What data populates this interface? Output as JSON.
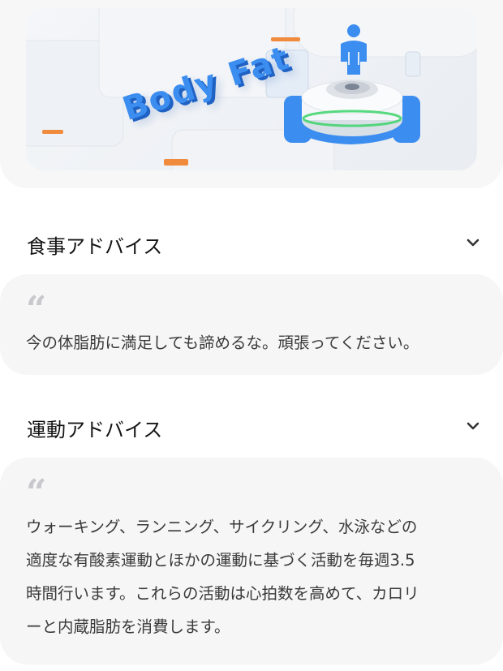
{
  "hero": {
    "brand_text": "Body Fat"
  },
  "diet_section": {
    "title": "食事アドバイス",
    "advice": "今の体脂肪に満足しても諦めるな。頑張ってください。"
  },
  "exercise_section": {
    "title": "運動アドバイス",
    "advice_lines": [
      "ウォーキング、ランニング、サイクリング、水泳などの",
      "適度な有酸素運動とほかの運動に基づく活動を毎週3.5",
      "時間行います。これらの活動は心拍数を高めて、カロリ",
      "ーと内蔵脂肪を消費します。"
    ]
  },
  "colors": {
    "accent_blue": "#3b8df0",
    "accent_orange": "#f08a3c",
    "ring_green": "#3bd46a",
    "card_background": "#f6f6f7"
  },
  "icons": {
    "quote": "quote-icon",
    "chevron": "chevron-down-icon"
  }
}
